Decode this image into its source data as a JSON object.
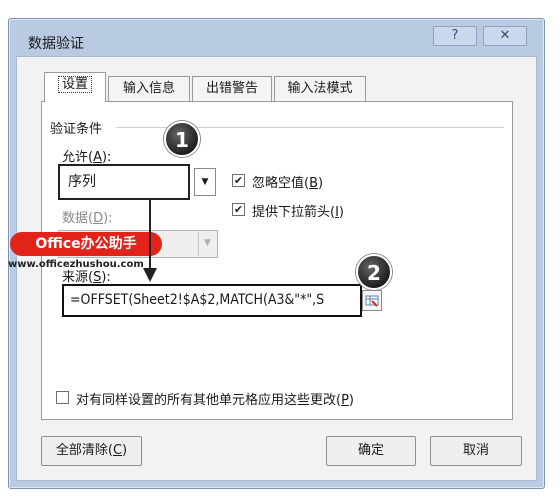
{
  "window": {
    "title": "数据验证",
    "help_label": "?",
    "close_label": "✕"
  },
  "tabs": [
    {
      "label": "设置"
    },
    {
      "label": "输入信息"
    },
    {
      "label": "出错警告"
    },
    {
      "label": "输入法模式"
    }
  ],
  "settings": {
    "group_title": "验证条件",
    "allow": {
      "label_pre": "允许(",
      "label_key": "A",
      "label_post": "):",
      "value": "序列"
    },
    "ignore_blank": {
      "label_pre": "忽略空值(",
      "label_key": "B",
      "label_post": ")",
      "checked": true
    },
    "dropdown": {
      "label_pre": "提供下拉箭头(",
      "label_key": "I",
      "label_post": ")",
      "checked": true
    },
    "data": {
      "label_pre": "数据(",
      "label_key": "D",
      "label_post": "):"
    },
    "source": {
      "label_pre": "来源(",
      "label_key": "S",
      "label_post": "):",
      "value": "=OFFSET(Sheet2!$A$2,MATCH(A3&\"*\",S"
    },
    "apply_all": {
      "label_pre": "对有同样设置的所有其他单元格应用这些更改(",
      "label_key": "P",
      "label_post": ")",
      "checked": false
    }
  },
  "buttons": {
    "clear_pre": "全部清除(",
    "clear_key": "C",
    "clear_post": ")",
    "ok": "确定",
    "cancel": "取消"
  },
  "annotations": {
    "step1": "1",
    "step2": "2",
    "badge": "Office办公助手",
    "site": "www.officezhushou.com"
  },
  "colors": {
    "badge_red": "#e2231a",
    "title_bar": "#b9cbe3"
  }
}
